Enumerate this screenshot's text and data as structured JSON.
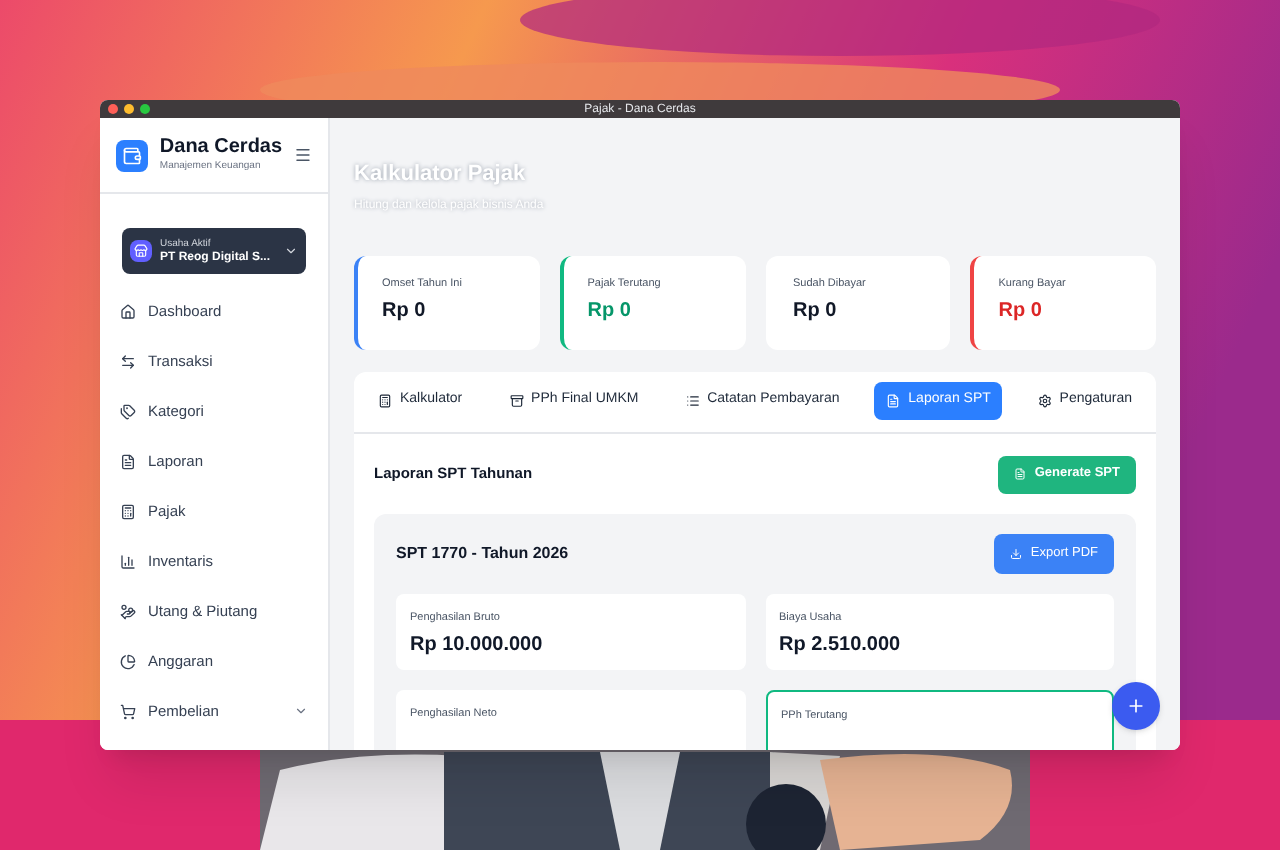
{
  "window": {
    "title": "Pajak - Dana Cerdas"
  },
  "brand": {
    "name": "Dana Cerdas",
    "tagline": "Manajemen Keuangan"
  },
  "business": {
    "label": "Usaha Aktif",
    "name": "PT Reog Digital S..."
  },
  "sidebar": {
    "items": [
      {
        "label": "Dashboard",
        "expandable": false
      },
      {
        "label": "Transaksi",
        "expandable": false
      },
      {
        "label": "Kategori",
        "expandable": false
      },
      {
        "label": "Laporan",
        "expandable": false
      },
      {
        "label": "Pajak",
        "expandable": false
      },
      {
        "label": "Inventaris",
        "expandable": false
      },
      {
        "label": "Utang & Piutang",
        "expandable": false
      },
      {
        "label": "Anggaran",
        "expandable": false
      },
      {
        "label": "Pembelian",
        "expandable": true
      }
    ]
  },
  "header": {
    "title": "Kalkulator Pajak",
    "subtitle": "Hitung dan kelola pajak bisnis Anda"
  },
  "stats": [
    {
      "label": "Omset Tahun Ini",
      "value": "Rp 0",
      "kind": "info"
    },
    {
      "label": "Pajak Terutang",
      "value": "Rp 0",
      "kind": "positive"
    },
    {
      "label": "Sudah Dibayar",
      "value": "Rp 0",
      "kind": "plain"
    },
    {
      "label": "Kurang Bayar",
      "value": "Rp 0",
      "kind": "negative"
    }
  ],
  "tabs": [
    {
      "label": "Kalkulator",
      "selected": false
    },
    {
      "label": "PPh Final UMKM",
      "selected": false
    },
    {
      "label": "Catatan Pembayaran",
      "selected": false
    },
    {
      "label": "Laporan SPT",
      "selected": true
    },
    {
      "label": "Pengaturan",
      "selected": false
    }
  ],
  "report": {
    "title": "Laporan SPT Tahunan",
    "button": "Generate SPT",
    "spt": {
      "title": "SPT 1770 - Tahun 2026",
      "button": "Export PDF",
      "items": [
        {
          "label": "Penghasilan Bruto",
          "value": "Rp 10.000.000",
          "highlighted": false
        },
        {
          "label": "Biaya Usaha",
          "value": "Rp 2.510.000",
          "highlighted": false
        },
        {
          "label": "Penghasilan Neto",
          "highlighted": false
        },
        {
          "label": "PPh Terutang",
          "highlighted": true
        }
      ]
    }
  }
}
